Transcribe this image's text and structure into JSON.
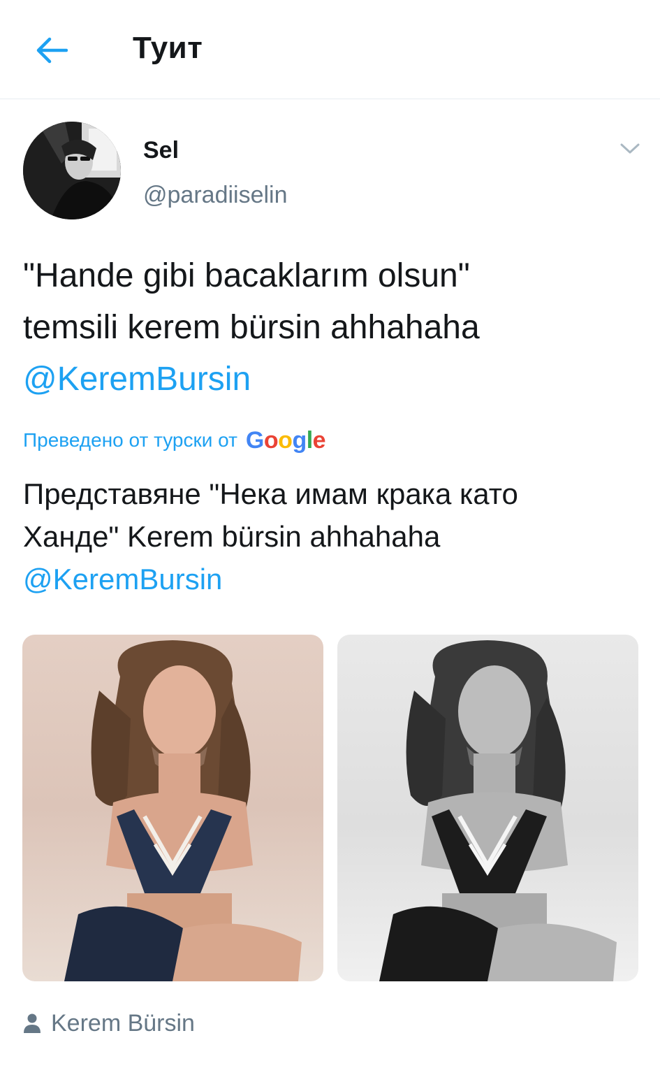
{
  "header": {
    "title": "Туит"
  },
  "tweet": {
    "display_name": "Sel",
    "handle": "@paradiiselin",
    "text_line1": "\"Hande gibi bacaklarım olsun\"",
    "text_line2": "temsili kerem bürsin ahhahaha",
    "mention": "@KeremBursin",
    "translated_label": "Преведено от турски от",
    "translated_provider": "Google",
    "translation_line1": "Представяне \"Нека имам крака като",
    "translation_line2": "Ханде\" Kerem bürsin ahhahaha",
    "translation_mention": "@KeremBursin",
    "tagged_user": "Kerem Bürsin"
  },
  "colors": {
    "accent": "#1da1f2",
    "text": "#14171a",
    "secondary": "#657786",
    "divider": "#e6ecf0"
  },
  "icons": {
    "back": "arrow-left-icon",
    "more": "chevron-down-icon",
    "tagged": "person-icon"
  }
}
